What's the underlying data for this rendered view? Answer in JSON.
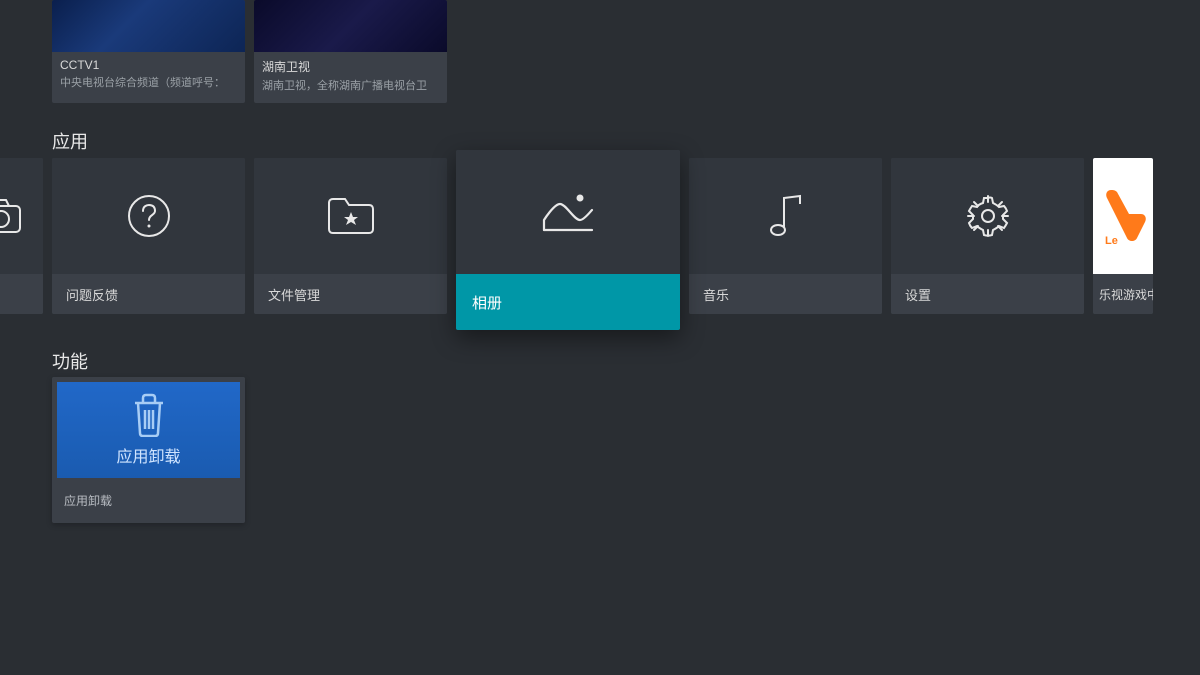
{
  "channels": [
    {
      "title": "CCTV1",
      "desc": "中央电视台综合频道（频道呼号："
    },
    {
      "title": "湖南卫视",
      "desc": "湖南卫视，全称湖南广播电视台卫"
    }
  ],
  "sections": {
    "apps": "应用",
    "functions": "功能"
  },
  "apps": [
    {
      "label": "",
      "icon": "camera-icon"
    },
    {
      "label": "问题反馈",
      "icon": "question-icon"
    },
    {
      "label": "文件管理",
      "icon": "folder-star-icon"
    },
    {
      "label": "相册",
      "icon": "gallery-icon",
      "focused": true
    },
    {
      "label": "音乐",
      "icon": "music-icon"
    },
    {
      "label": "设置",
      "icon": "gear-icon"
    },
    {
      "label": "乐视游戏中心",
      "icon": "le-icon"
    }
  ],
  "functions": [
    {
      "label": "应用卸载",
      "image_text": "应用卸载",
      "icon": "trash-icon"
    }
  ],
  "colors": {
    "bg": "#2a2e33",
    "card": "#3b4048",
    "card_icon_bg": "#31363d",
    "accent": "#0097a7",
    "le_orange": "#ff7a1a"
  }
}
